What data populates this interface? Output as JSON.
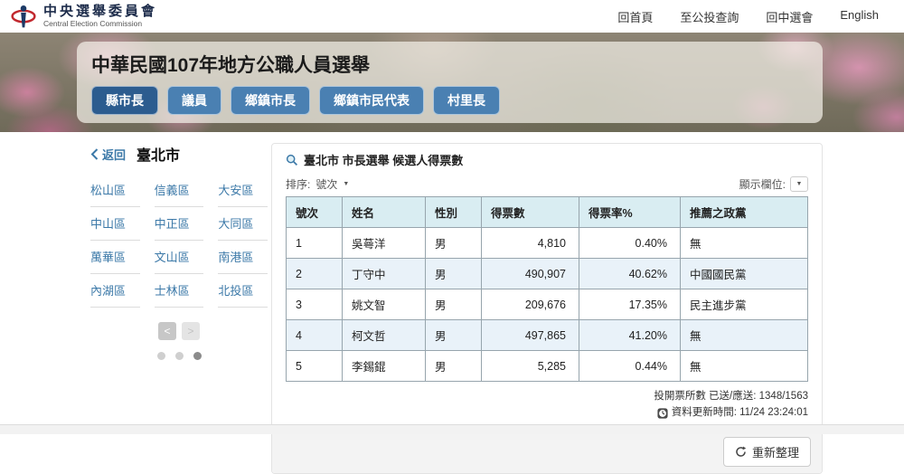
{
  "topbar": {
    "logo_title": "中央選舉委員會",
    "logo_subtitle": "Central Election Commission",
    "links": [
      "回首頁",
      "至公投查詢",
      "回中選會",
      "English"
    ]
  },
  "banner": {
    "title": "中華民國107年地方公職人員選舉",
    "tabs": [
      {
        "label": "縣市長",
        "active": true
      },
      {
        "label": "議員",
        "active": false
      },
      {
        "label": "鄉鎮市長",
        "active": false
      },
      {
        "label": "鄉鎮市民代表",
        "active": false
      },
      {
        "label": "村里長",
        "active": false
      }
    ]
  },
  "sidebar": {
    "back_label": "返回",
    "region": "臺北市",
    "districts": [
      "松山區",
      "信義區",
      "大安區",
      "中山區",
      "中正區",
      "大同區",
      "萬華區",
      "文山區",
      "南港區",
      "內湖區",
      "士林區",
      "北投區"
    ],
    "pagination": {
      "prev": "<",
      "next": ">",
      "active_dot_index": 2
    }
  },
  "main": {
    "title": "臺北市 市長選舉 候選人得票數",
    "sort_label": "排序:",
    "sort_value": "號次",
    "columns_label": "顯示欄位:",
    "table": {
      "headers": [
        "號次",
        "姓名",
        "性別",
        "得票數",
        "得票率%",
        "推薦之政黨"
      ],
      "rows": [
        {
          "number": "1",
          "name": "吳蕚洋",
          "gender": "男",
          "votes": "4,810",
          "rate": "0.40%",
          "party": "無"
        },
        {
          "number": "2",
          "name": "丁守中",
          "gender": "男",
          "votes": "490,907",
          "rate": "40.62%",
          "party": "中國國民黨"
        },
        {
          "number": "3",
          "name": "姚文智",
          "gender": "男",
          "votes": "209,676",
          "rate": "17.35%",
          "party": "民主進步黨"
        },
        {
          "number": "4",
          "name": "柯文哲",
          "gender": "男",
          "votes": "497,865",
          "rate": "41.20%",
          "party": "無"
        },
        {
          "number": "5",
          "name": "李錫錕",
          "gender": "男",
          "votes": "5,285",
          "rate": "0.44%",
          "party": "無"
        }
      ]
    },
    "stats": {
      "stations": "投開票所數 已送/應送: 1348/1563",
      "updated": "資料更新時間: 11/24 23:24:01"
    },
    "refresh_label": "重新整理"
  },
  "colors": {
    "link_blue": "#3c79a8",
    "tab_active": "#2c5c8f",
    "tab_normal": "#4a80b2",
    "table_header_bg": "#d9edf2",
    "row_alt_bg": "#e9f2f9",
    "logo_red": "#c1272d",
    "logo_navy": "#1c3a66"
  }
}
